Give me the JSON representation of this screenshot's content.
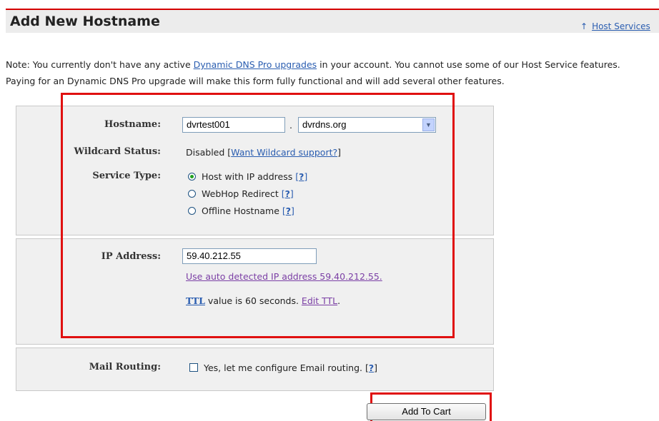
{
  "header": {
    "title": "Add New Hostname",
    "host_services_link": "Host Services",
    "host_services_arrow": "↑"
  },
  "note": {
    "prefix": "Note: You currently don't have any active ",
    "link": "Dynamic DNS Pro upgrades",
    "suffix": " in your account. You cannot use some of our Host Service features. Paying for an Dynamic DNS Pro upgrade will make this form fully functional and will add several other features."
  },
  "form": {
    "hostname": {
      "label": "Hostname:",
      "value": "dvrtest001",
      "separator": ".",
      "domain_selected": "dvrdns.org"
    },
    "wildcard": {
      "label": "Wildcard Status:",
      "status": "Disabled [",
      "link": "Want Wildcard support?",
      "close": "]"
    },
    "service_type": {
      "label": "Service Type:",
      "options": [
        {
          "label": "Host with IP address",
          "help": "?",
          "selected": true
        },
        {
          "label": "WebHop Redirect",
          "help": "?",
          "selected": false
        },
        {
          "label": "Offline Hostname",
          "help": "?",
          "selected": false
        }
      ]
    },
    "ip": {
      "label": "IP Address:",
      "value": "59.40.212.55",
      "auto_link": "Use auto detected IP address 59.40.212.55.",
      "ttl_link": "TTL",
      "ttl_text": " value is 60 seconds. ",
      "edit_ttl": "Edit TTL"
    },
    "mail": {
      "label": "Mail Routing:",
      "checkbox_label": "Yes, let me configure Email routing. [",
      "help": "?",
      "close": "]",
      "checked": false
    }
  },
  "actions": {
    "add_to_cart": "Add To Cart"
  },
  "colors": {
    "highlight_red": "#e01010",
    "link_blue": "#2a5db0",
    "visited_purple": "#7b3fa5",
    "panel_gray": "#f0f0f0"
  }
}
